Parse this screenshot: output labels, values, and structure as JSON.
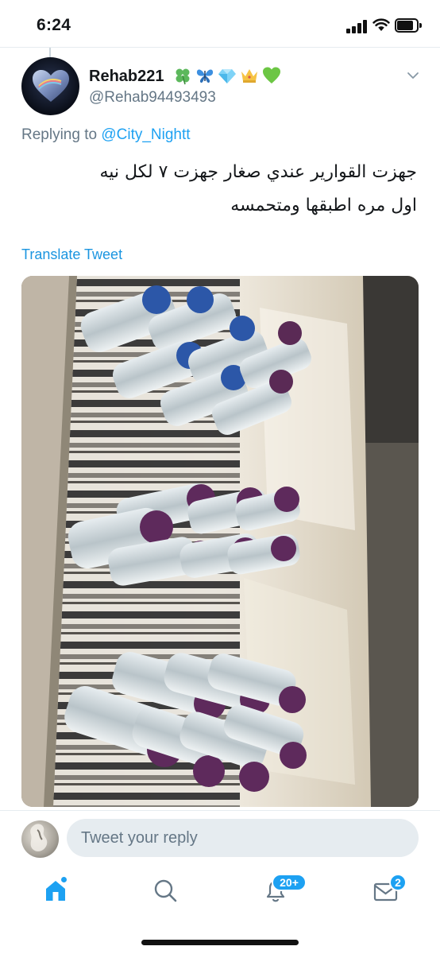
{
  "status_bar": {
    "time": "6:24"
  },
  "tweet": {
    "display_name": "Rehab221",
    "name_emojis": [
      "four-leaf-clover",
      "butterfly",
      "gem",
      "crown",
      "green-heart"
    ],
    "handle": "@Rehab94493493",
    "replying_prefix": "Replying to",
    "replying_to": "@City_Nightt",
    "text_line1": "جهزت القوارير عندي صغار جهزت ٧ لكل نيه",
    "text_line2": "اول مره اطبقها ومتحمسه",
    "translate_label": "Translate Tweet",
    "photo": "water-bottles-on-table"
  },
  "reply": {
    "placeholder": "Tweet your reply"
  },
  "tabbar": {
    "home_icon": "home-icon",
    "search_icon": "search-icon",
    "notifications_icon": "bell-icon",
    "notifications_badge": "20+",
    "messages_icon": "envelope-icon",
    "messages_badge": "2",
    "accent": "#1da1f2"
  }
}
